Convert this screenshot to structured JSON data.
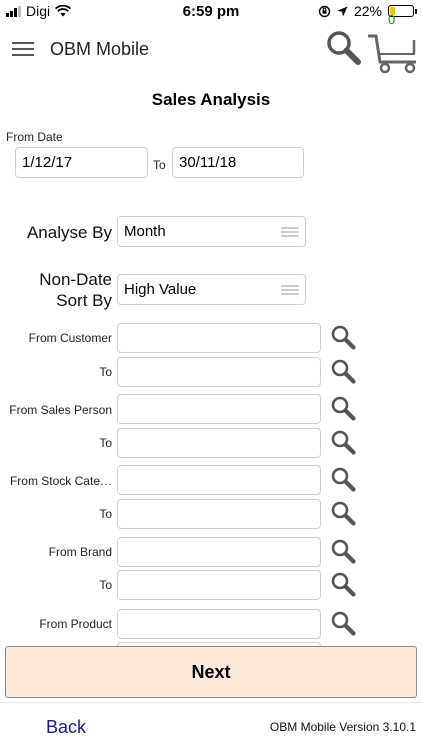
{
  "status_bar": {
    "carrier": "Digi",
    "time": "6:59 pm",
    "battery": "22%",
    "battery_level": 0.22,
    "battery_color": "#f2c200"
  },
  "header": {
    "title": "OBM Mobile",
    "cart_count": "0",
    "icons": [
      "hamburger-menu-icon",
      "search-icon",
      "cart-icon"
    ]
  },
  "page": {
    "title": "Sales Analysis",
    "from_date_label": "From Date",
    "from_date": "1/12/17",
    "to_label": "To",
    "to_date": "30/11/18",
    "analyse_by_label": "Analyse By",
    "analyse_by_value": "Month",
    "sort_label_line1": "Non-Date",
    "sort_label_line2": "Sort By",
    "sort_value": "High Value"
  },
  "range_fields": [
    {
      "label": "From Customer",
      "value": ""
    },
    {
      "label": "To",
      "value": ""
    },
    {
      "label": "From Sales Person",
      "value": ""
    },
    {
      "label": "To",
      "value": ""
    },
    {
      "label": "From Stock Cate…",
      "value": ""
    },
    {
      "label": "To",
      "value": ""
    },
    {
      "label": "From Brand",
      "value": ""
    },
    {
      "label": "To",
      "value": ""
    },
    {
      "label": "From Product",
      "value": ""
    }
  ],
  "next_label": "Next",
  "footer": {
    "back_label": "Back",
    "version": "OBM Mobile Version 3.10.1"
  },
  "colors": {
    "next_bg": "#fde9dc",
    "back_link": "#1a1a8a",
    "cart_count": "#1a8a1a"
  }
}
